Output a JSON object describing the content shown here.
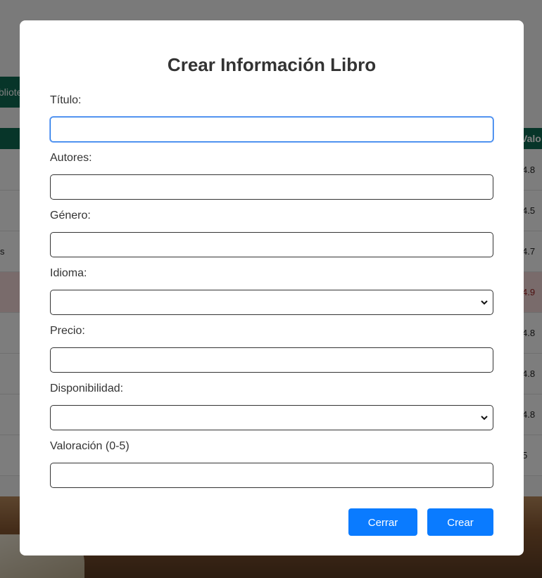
{
  "background": {
    "nav_button_fragment": "bliote",
    "table_header_fragment": "Valo",
    "row_left_fragment": "s",
    "ratings": [
      "4.8",
      "4.5",
      "4.7",
      "4.9",
      "4.8",
      "4.8",
      "4.8",
      "5"
    ]
  },
  "modal": {
    "title": "Crear Información Libro",
    "fields": {
      "titulo": {
        "label": "Título:",
        "value": ""
      },
      "autores": {
        "label": "Autores:",
        "value": ""
      },
      "genero": {
        "label": "Género:",
        "value": ""
      },
      "idioma": {
        "label": "Idioma:",
        "selected": ""
      },
      "precio": {
        "label": "Precio:",
        "value": ""
      },
      "disponibilidad": {
        "label": "Disponibilidad:",
        "selected": ""
      },
      "valoracion": {
        "label": "Valoración (0-5)",
        "value": ""
      }
    },
    "buttons": {
      "close_label": "Cerrar",
      "create_label": "Crear"
    }
  },
  "colors": {
    "primary_button": "#0a7bff",
    "header_green": "#0f6b52",
    "focus_blue": "#1a73e8",
    "highlight_row": "#f3d6d6"
  },
  "icons": {
    "select_arrow": "chevron-down-icon"
  }
}
